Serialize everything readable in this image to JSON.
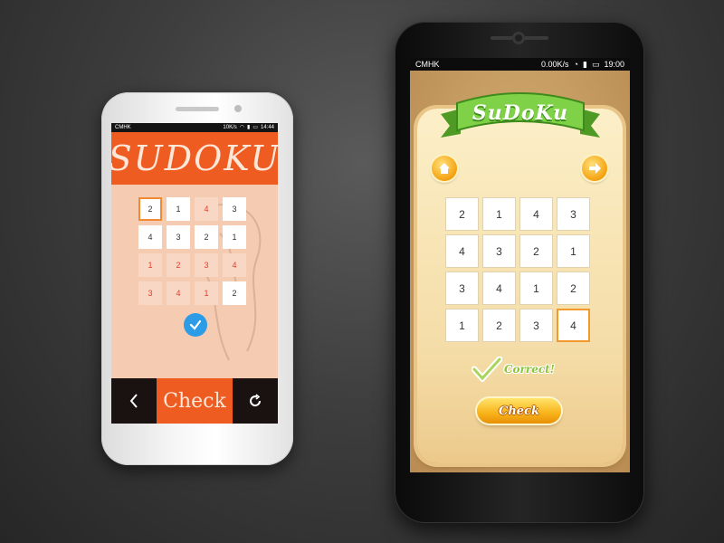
{
  "left_phone": {
    "status": {
      "carrier": "CMHK",
      "speed": "10K/s",
      "time": "14:44"
    },
    "title": "SUDOKU",
    "grid": [
      [
        {
          "v": "2",
          "given": false,
          "sel": true
        },
        {
          "v": "1",
          "given": false
        },
        {
          "v": "4",
          "given": true
        },
        {
          "v": "3",
          "given": false
        }
      ],
      [
        {
          "v": "4",
          "given": false
        },
        {
          "v": "3",
          "given": false
        },
        {
          "v": "2",
          "given": false
        },
        {
          "v": "1",
          "given": false
        }
      ],
      [
        {
          "v": "1",
          "given": true
        },
        {
          "v": "2",
          "given": true
        },
        {
          "v": "3",
          "given": true
        },
        {
          "v": "4",
          "given": true
        }
      ],
      [
        {
          "v": "3",
          "given": true
        },
        {
          "v": "4",
          "given": true
        },
        {
          "v": "1",
          "given": true
        },
        {
          "v": "2",
          "given": false
        }
      ]
    ],
    "check_label": "Check",
    "colors": {
      "accent": "#ef5c22",
      "board_bg": "#f5cbb1",
      "success": "#2d9ce6"
    },
    "icons": {
      "back": "chevron-left-icon",
      "refresh": "refresh-icon",
      "done": "check-circle-icon"
    }
  },
  "right_phone": {
    "status": {
      "carrier": "CMHK",
      "speed": "0.00K/s",
      "time": "19:00"
    },
    "title": "SuDoKu",
    "grid": [
      [
        {
          "v": "2"
        },
        {
          "v": "1"
        },
        {
          "v": "4"
        },
        {
          "v": "3"
        }
      ],
      [
        {
          "v": "4"
        },
        {
          "v": "3"
        },
        {
          "v": "2"
        },
        {
          "v": "1"
        }
      ],
      [
        {
          "v": "3"
        },
        {
          "v": "4"
        },
        {
          "v": "1"
        },
        {
          "v": "2"
        }
      ],
      [
        {
          "v": "1"
        },
        {
          "v": "2"
        },
        {
          "v": "3"
        },
        {
          "v": "4",
          "sel": true
        }
      ]
    ],
    "correct_label": "Correct!",
    "check_label": "Check",
    "colors": {
      "banner": "#6ac23a",
      "parchment": "#f8e6b6",
      "button": "#f8b319"
    },
    "icons": {
      "home": "home-icon",
      "next": "arrow-right-icon",
      "correct": "checkmark-icon"
    }
  }
}
